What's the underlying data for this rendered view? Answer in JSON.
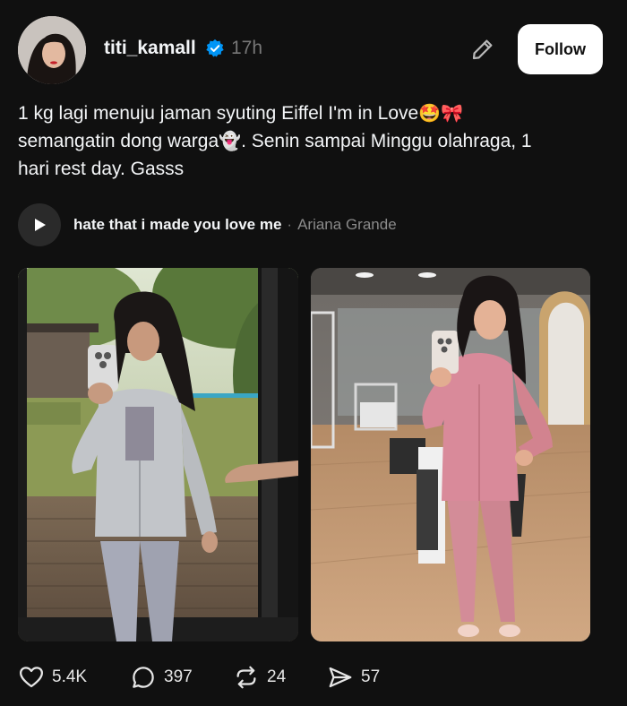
{
  "post": {
    "username": "titi_kamall",
    "timestamp": "17h",
    "follow_label": "Follow",
    "caption": {
      "line1": "1 kg lagi menuju jaman syuting Eiffel I'm in Love",
      "emoji1": "🤩",
      "emoji2": "🎀",
      "line2a": "semangatin dong warga",
      "emoji3": "👻",
      "line2b": ". Senin sampai Minggu olahraga, 1",
      "line3": "hari rest day. Gasss"
    },
    "music": {
      "title": "hate that i made you love me",
      "separator": "·",
      "artist": "Ariana Grande"
    },
    "stats": {
      "likes": "5.4K",
      "replies": "397",
      "reposts": "24",
      "shares": "57"
    }
  },
  "colors": {
    "background": "#101010",
    "text": "#f3f5f7",
    "muted": "#777777",
    "verified_blue": "#0095f6"
  },
  "icons": {
    "verified": "verified-badge-icon",
    "edit": "pencil-icon",
    "play": "play-icon",
    "like": "heart-icon",
    "reply": "comment-icon",
    "repost": "repost-icon",
    "share": "send-icon"
  }
}
